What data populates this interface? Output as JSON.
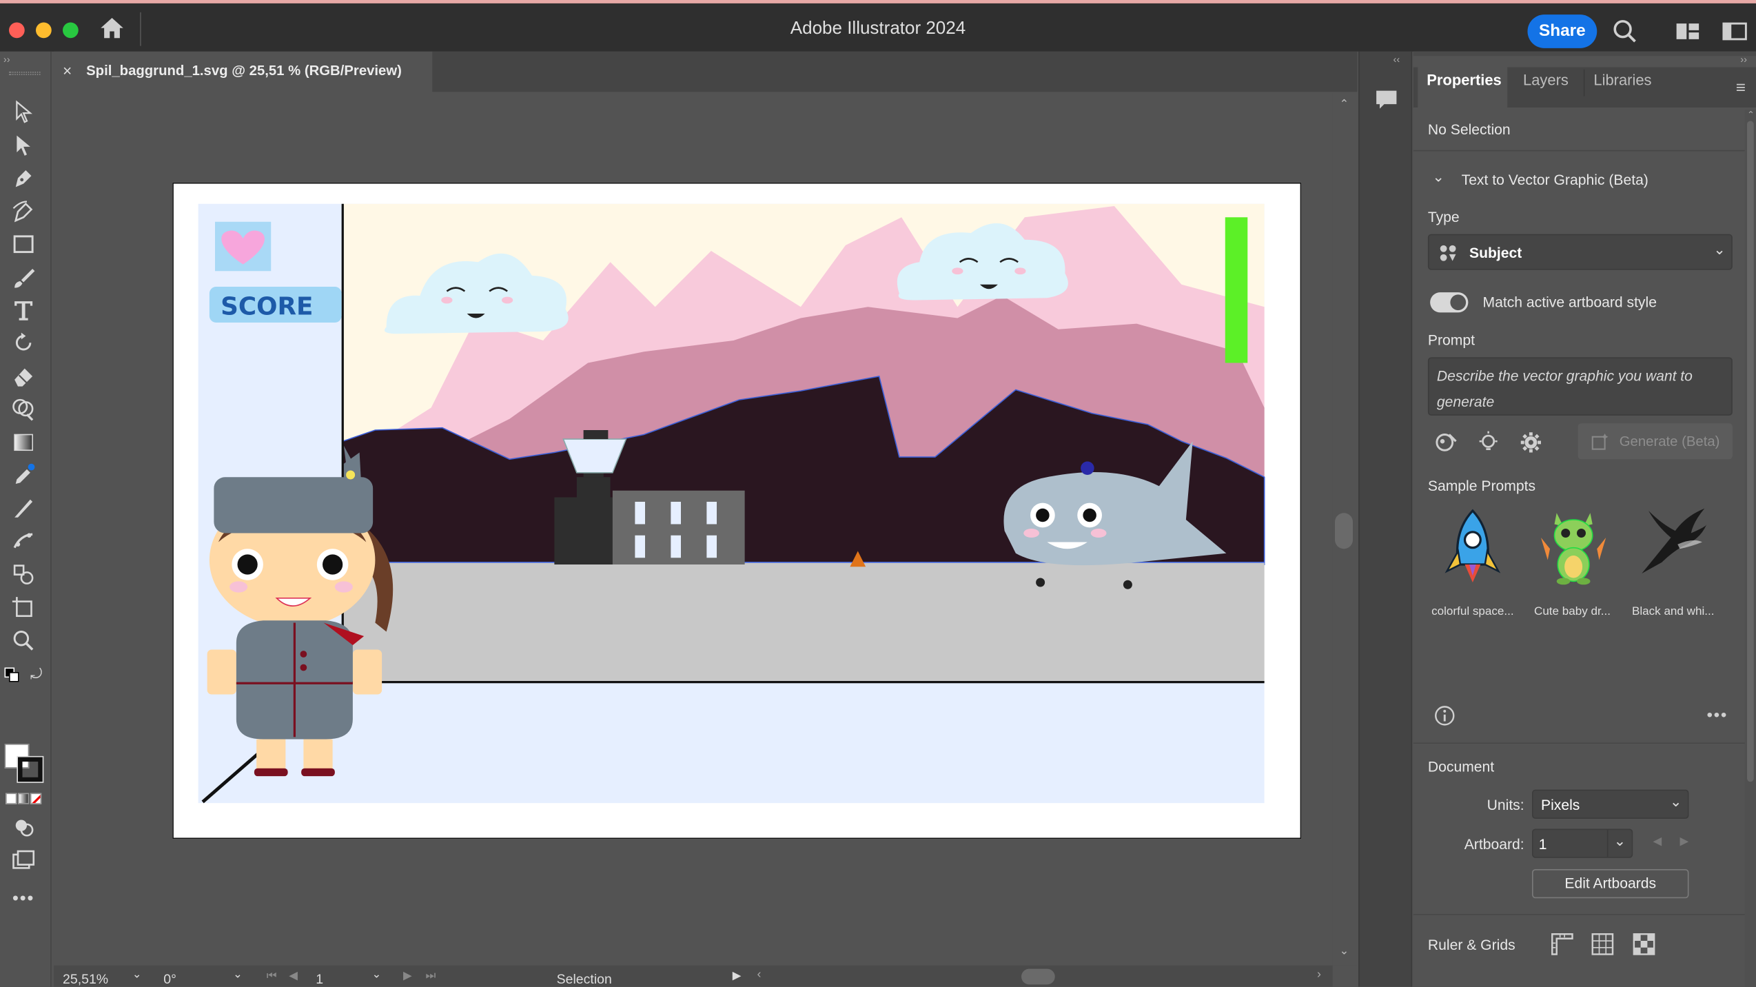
{
  "app": {
    "title": "Adobe Illustrator 2024",
    "share_label": "Share"
  },
  "document": {
    "tab_title": "Spil_baggrund_1.svg @ 25,51 % (RGB/Preview)"
  },
  "artwork": {
    "score_text": "SCORE"
  },
  "status": {
    "zoom": "25,51%",
    "rotation": "0°",
    "artboard_number": "1",
    "tool": "Selection"
  },
  "panel": {
    "tabs": [
      "Properties",
      "Layers",
      "Libraries"
    ],
    "selection": "No Selection",
    "t2v": {
      "title": "Text to Vector Graphic (Beta)",
      "type_label": "Type",
      "type_value": "Subject",
      "match_label": "Match active artboard style",
      "prompt_label": "Prompt",
      "prompt_placeholder": "Describe the vector graphic you want to generate",
      "generate_label": "Generate (Beta)",
      "samples_label": "Sample Prompts",
      "samples": [
        {
          "caption": "colorful space...",
          "icon": "rocket-icon"
        },
        {
          "caption": "Cute baby dr...",
          "icon": "baby-dragon-icon"
        },
        {
          "caption": "Black and whi...",
          "icon": "black-bird-icon"
        }
      ]
    },
    "document": {
      "section_label": "Document",
      "units_label": "Units:",
      "units_value": "Pixels",
      "artboard_label": "Artboard:",
      "artboard_value": "1",
      "edit_artboards_label": "Edit Artboards"
    },
    "ruler_label": "Ruler & Grids"
  },
  "colors": {
    "accent": "#1473e6",
    "chrome_dark": "#2f2f2f",
    "panel": "#535353",
    "green_bar": "#5cf027"
  }
}
